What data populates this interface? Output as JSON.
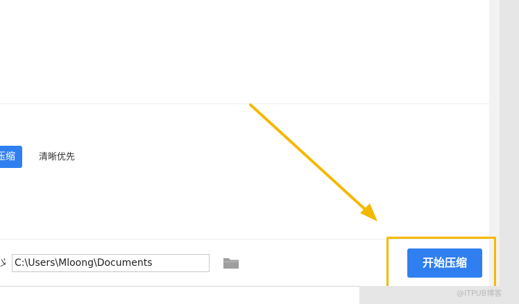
{
  "compression_modes": {
    "active_label": "压缩",
    "clarity_label": "清晰优先"
  },
  "output": {
    "label_fragment": "义",
    "path_value": "C:\\Users\\Mloong\\Documents"
  },
  "actions": {
    "start_label": "开始压缩"
  },
  "annotation": {
    "highlight_color": "#f5b800"
  },
  "watermark": {
    "text": "@ITPUB博客"
  },
  "colors": {
    "accent": "#2f7ff0"
  }
}
